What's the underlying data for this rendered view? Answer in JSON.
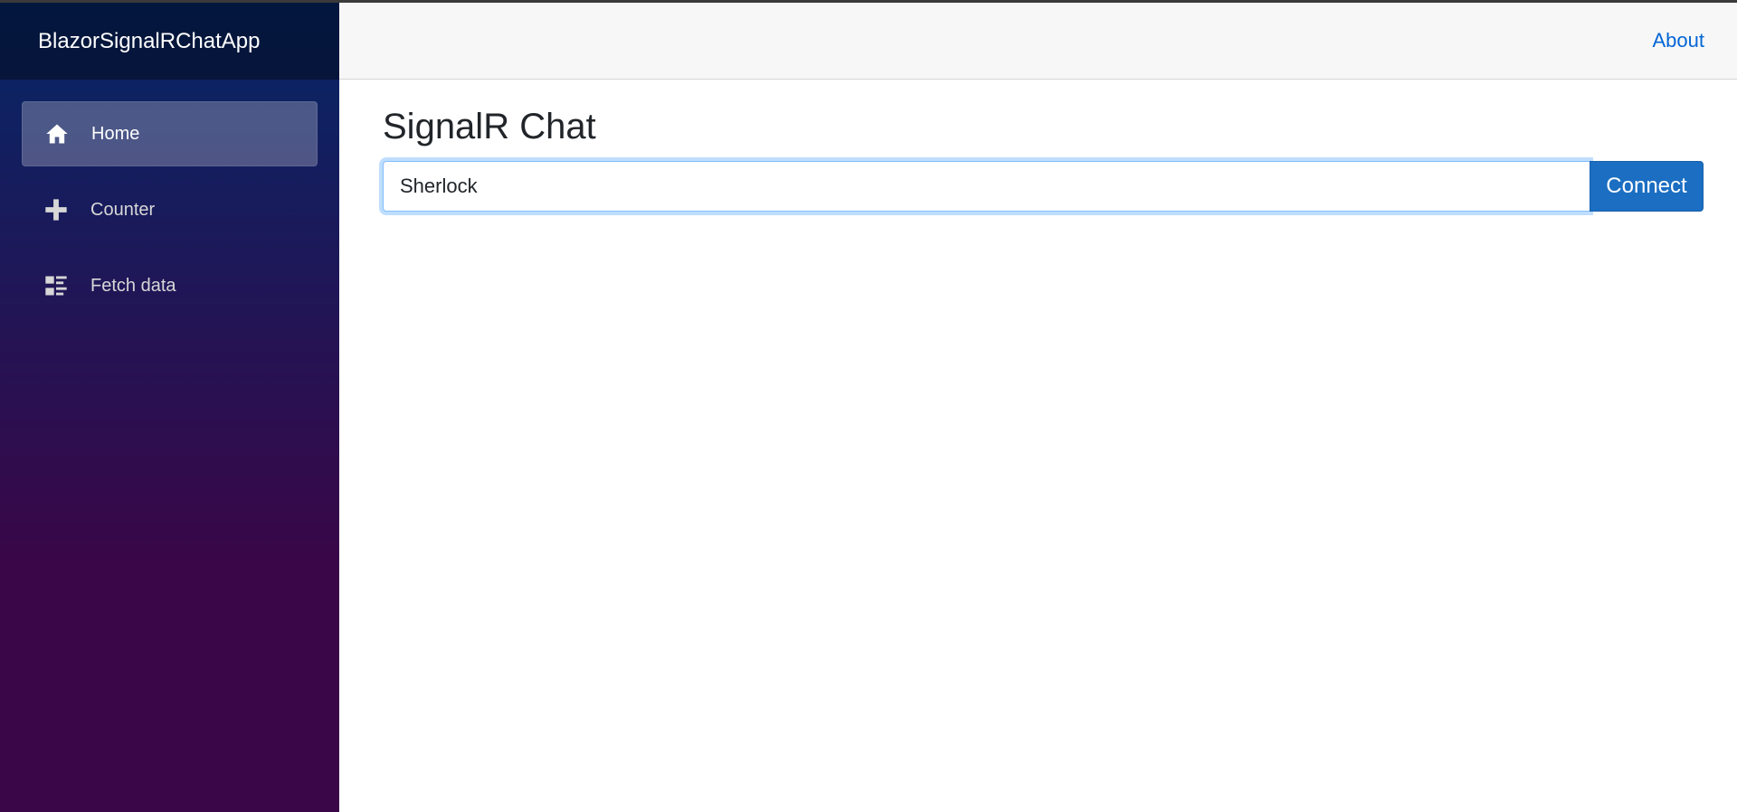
{
  "app": {
    "brand": "BlazorSignalRChatApp"
  },
  "sidebar": {
    "items": [
      {
        "label": "Home",
        "icon": "home-icon",
        "active": true
      },
      {
        "label": "Counter",
        "icon": "plus-icon",
        "active": false
      },
      {
        "label": "Fetch data",
        "icon": "list-icon",
        "active": false
      }
    ]
  },
  "header": {
    "about_label": "About"
  },
  "main": {
    "title": "SignalR Chat",
    "username_value": "Sherlock",
    "connect_label": "Connect"
  },
  "colors": {
    "accent": "#1b6ec2",
    "link": "#0366d6",
    "sidebar_top": "#052767",
    "sidebar_bottom": "#3a0647"
  }
}
